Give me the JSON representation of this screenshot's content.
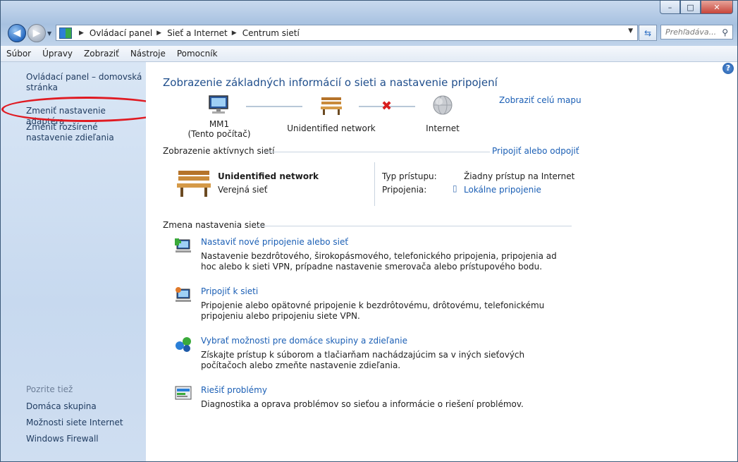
{
  "window": {
    "controls": {
      "minimize": "–",
      "maximize": "□",
      "close": "✕"
    }
  },
  "nav": {
    "breadcrumb": [
      "Ovládací panel",
      "Sieť a Internet",
      "Centrum sietí"
    ],
    "search_placeholder": "Prehľadáva..."
  },
  "menu": [
    "Súbor",
    "Úpravy",
    "Zobraziť",
    "Nástroje",
    "Pomocník"
  ],
  "sidebar": {
    "links": [
      "Ovládací panel – domovská stránka",
      "Zmeniť nastavenie adaptéra",
      "Zmeniť rozšírené nastavenie zdieľania"
    ],
    "see_also_heading": "Pozrite tiež",
    "see_also": [
      "Domáca skupina",
      "Možnosti siete Internet",
      "Windows Firewall"
    ]
  },
  "main": {
    "title": "Zobrazenie základných informácií o sieti a nastavenie pripojení",
    "full_map_link": "Zobraziť celú mapu",
    "map": {
      "computer_name": "MM1",
      "computer_sub": "(Tento počítač)",
      "network": "Unidentified network",
      "internet": "Internet"
    },
    "active_heading": "Zobrazenie aktívnych sietí",
    "connect_link": "Pripojiť alebo odpojiť",
    "active": {
      "name": "Unidentified network",
      "type": "Verejná sieť",
      "access_label": "Typ prístupu:",
      "access_value": "Žiadny prístup na Internet",
      "connections_label": "Pripojenia:",
      "connections_value": "Lokálne pripojenie"
    },
    "change_heading": "Zmena nastavenia siete",
    "tasks": [
      {
        "label": "Nastaviť nové pripojenie alebo sieť",
        "desc": "Nastavenie bezdrôtového, širokopásmového, telefonického pripojenia, pripojenia ad hoc alebo k sieti VPN, prípadne nastavenie smerovača alebo prístupového bodu."
      },
      {
        "label": "Pripojiť k sieti",
        "desc": "Pripojenie alebo opätovné pripojenie k bezdrôtovému, drôtovému, telefonickému pripojeniu alebo pripojeniu siete VPN."
      },
      {
        "label": "Vybrať možnosti pre domáce skupiny a zdieľanie",
        "desc": "Získajte prístup k súborom a tlačiarňam nachádzajúcim sa v iných sieťových počítačoch alebo zmeňte nastavenie zdieľania."
      },
      {
        "label": "Riešiť problémy",
        "desc": "Diagnostika a oprava problémov so sieťou a informácie o riešení problémov."
      }
    ]
  }
}
